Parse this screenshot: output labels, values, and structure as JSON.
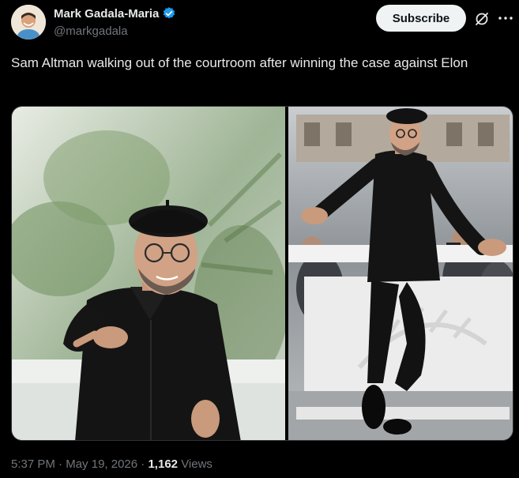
{
  "author": {
    "display_name": "Mark Gadala-Maria",
    "handle": "@markgadala",
    "verified": true,
    "avatar_icon": "user-avatar"
  },
  "actions": {
    "subscribe_label": "Subscribe",
    "grok_icon": "grok-icon",
    "more_icon": "more-icon"
  },
  "tweet": {
    "text": "Sam Altman walking out of the courtroom after winning the case against Elon"
  },
  "meta": {
    "time": "5:37 PM",
    "separator": "·",
    "date": "May 19, 2026",
    "views_count": "1,162",
    "views_label": "Views"
  },
  "colors": {
    "background": "#000000",
    "text_primary": "#e7e9ea",
    "text_secondary": "#71767b",
    "verified_blue": "#1d9bf0"
  }
}
